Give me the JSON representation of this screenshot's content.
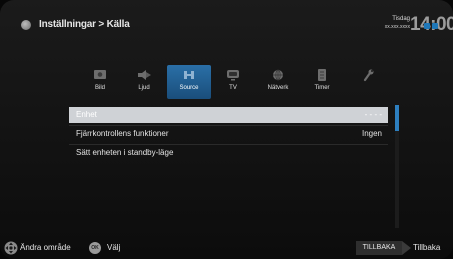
{
  "header": {
    "title": "Inställningar > Källa",
    "day": "Tisdag",
    "date": "xx.xxx.xxxx",
    "clock": "14:00",
    "icon": "settings-dot-icon"
  },
  "tabs": [
    {
      "label": "Bild",
      "icon": "picture-icon"
    },
    {
      "label": "Ljud",
      "icon": "speaker-icon"
    },
    {
      "label": "Source",
      "icon": "source-icon",
      "active": true
    },
    {
      "label": "TV",
      "icon": "tv-icon"
    },
    {
      "label": "Nätverk",
      "icon": "network-icon"
    },
    {
      "label": "Timer",
      "icon": "timer-icon"
    },
    {
      "label": "",
      "icon": "tools-icon"
    }
  ],
  "menu": {
    "items": [
      {
        "label": "Enhet",
        "value": "- - - -",
        "selected": true
      },
      {
        "label": "Fjärrkontrollens funktioner",
        "value": "Ingen"
      },
      {
        "label": "Sätt enheten i standby-läge",
        "value": ""
      }
    ]
  },
  "footer": {
    "move_label": "Ändra område",
    "ok_key": "OK",
    "ok_label": "Välj",
    "back_key": "TILLBAKA",
    "back_label": "Tillbaka"
  },
  "colors": {
    "accent": "#2d7fbf",
    "selected_row": "#cfd2d6",
    "background": "#141414"
  }
}
